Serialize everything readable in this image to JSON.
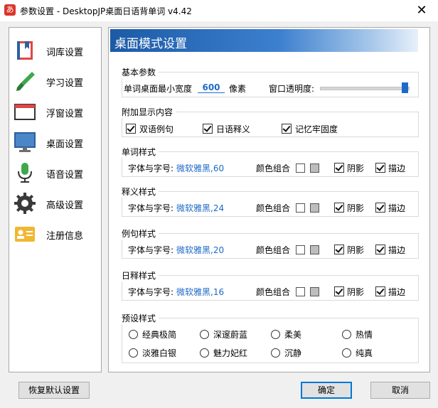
{
  "window": {
    "title": "参数设置 - DesktopJP桌面日语背单词 v4.42",
    "app_icon_char": "あ",
    "close_glyph": "✕"
  },
  "sidebar": {
    "items": [
      {
        "label": "词库设置",
        "icon": "book-icon"
      },
      {
        "label": "学习设置",
        "icon": "brush-icon"
      },
      {
        "label": "浮窗设置",
        "icon": "floating-window-icon"
      },
      {
        "label": "桌面设置",
        "icon": "monitor-icon"
      },
      {
        "label": "语音设置",
        "icon": "microphone-icon"
      },
      {
        "label": "高级设置",
        "icon": "gear-icon"
      },
      {
        "label": "注册信息",
        "icon": "id-card-icon"
      }
    ]
  },
  "panel": {
    "title": "桌面模式设置",
    "basic": {
      "title": "基本参数",
      "min_width_label": "单词桌面最小宽度",
      "min_width_value": "600",
      "min_width_unit": "像素",
      "opacity_label": "窗口透明度:",
      "opacity_value": 1.0
    },
    "extra": {
      "title": "附加显示内容",
      "options": [
        {
          "label": "双语例句",
          "checked": true
        },
        {
          "label": "日语释义",
          "checked": true
        },
        {
          "label": "记忆牢固度",
          "checked": true
        }
      ]
    },
    "styles": [
      {
        "title": "单词样式",
        "font_label": "字体与字号:",
        "font_value": "微软雅黑,60",
        "color_label": "颜色组合",
        "shadow_label": "阴影",
        "shadow": true,
        "outline_label": "描边",
        "outline": true
      },
      {
        "title": "释义样式",
        "font_label": "字体与字号:",
        "font_value": "微软雅黑,24",
        "color_label": "颜色组合",
        "shadow_label": "阴影",
        "shadow": true,
        "outline_label": "描边",
        "outline": true
      },
      {
        "title": "例句样式",
        "font_label": "字体与字号:",
        "font_value": "微软雅黑,20",
        "color_label": "颜色组合",
        "shadow_label": "阴影",
        "shadow": true,
        "outline_label": "描边",
        "outline": true
      },
      {
        "title": "日释样式",
        "font_label": "字体与字号:",
        "font_value": "微软雅黑,16",
        "color_label": "颜色组合",
        "shadow_label": "阴影",
        "shadow": true,
        "outline_label": "描边",
        "outline": true
      }
    ],
    "swatch_colors": [
      "#ffffff",
      "#bdbdbd"
    ],
    "presets": {
      "title": "预设样式",
      "options": [
        "经典极简",
        "深邃蔚蓝",
        "柔美",
        "热情",
        "淡雅白银",
        "魅力妃红",
        "沉静",
        "纯真"
      ]
    }
  },
  "footer": {
    "restore_label": "恢复默认设置",
    "ok_label": "确定",
    "cancel_label": "取消"
  }
}
